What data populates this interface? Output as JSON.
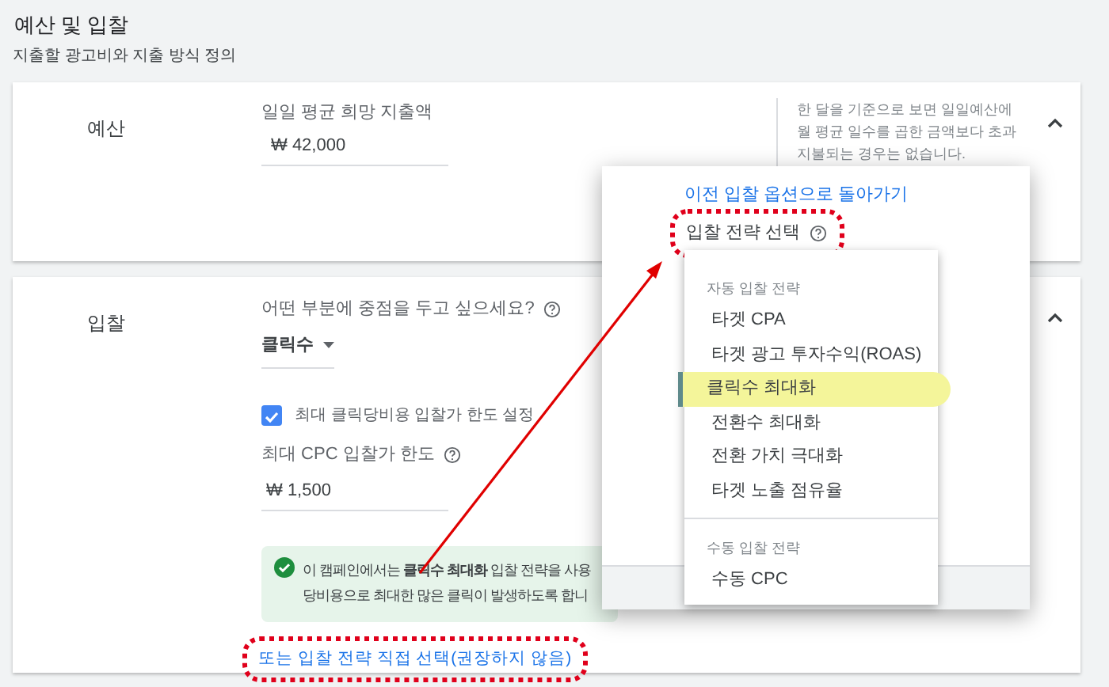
{
  "section": {
    "title": "예산 및 입찰",
    "subtitle": "지출할 광고비와 지출 방식 정의"
  },
  "budget": {
    "label": "예산",
    "field_label": "일일 평균 희망 지출액",
    "value": "₩ 42,000",
    "note": [
      "한 달을 기준으로 보면 일일예산에",
      "월 평균 일수를 곱한 금액보다 초과",
      "지불되는 경우는 없습니다."
    ],
    "expanded": true
  },
  "bidding": {
    "label": "입찰",
    "question": "어떤 부분에 중점을 두고 싶으세요?",
    "focus": "클릭수",
    "max_cpc_checkbox": {
      "label": "최대 클릭당비용 입찰가 한도 설정",
      "checked": true
    },
    "max_cpc_label": "최대 CPC 입찰가 한도",
    "max_cpc_value": "₩ 1,500",
    "info": [
      "이 캠페인에서는 **클릭수 최대화** 입찰 전략을 사용",
      "당비용으로 최대한 많은 클릭이 발생하도록 합니"
    ],
    "direct_link": {
      "text": "또는 입찰 전략 직접 선택(권장하지 않음)",
      "annotated": true
    },
    "expanded": true
  },
  "popup": {
    "back_link": "이전 입찰 옵션으로 돌아가기",
    "strategy_label": {
      "text": "입찰 전략 선택",
      "annotated": true
    },
    "menu_groups": [
      {
        "heading": "자동 입찰 전략",
        "options": [
          {
            "text": "타겟 CPA",
            "selected": false,
            "highlighted": false
          },
          {
            "text": "타겟 광고 투자수익(ROAS)",
            "selected": false,
            "highlighted": false
          },
          {
            "text": "클릭수 최대화",
            "selected": true,
            "highlighted": true
          },
          {
            "text": "전환수 최대화",
            "selected": false,
            "highlighted": false
          },
          {
            "text": "전환 가치 극대화",
            "selected": false,
            "highlighted": false
          },
          {
            "text": "타겟 노출 점유율",
            "selected": false,
            "highlighted": false
          }
        ]
      },
      {
        "heading": "수동 입찰 전략",
        "options": [
          {
            "text": "수동 CPC",
            "selected": false,
            "highlighted": false
          }
        ]
      }
    ]
  },
  "annotation_arrow": true
}
